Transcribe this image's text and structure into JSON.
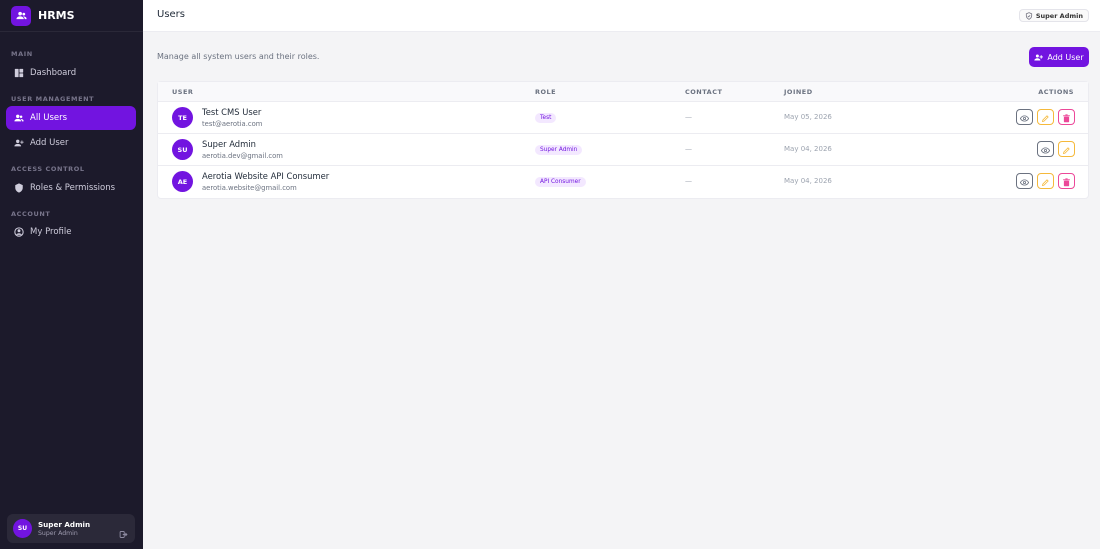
{
  "app": {
    "name": "HRMS"
  },
  "sidebar": {
    "sections": {
      "main": "MAIN",
      "user_management": "USER MANAGEMENT",
      "access_control": "ACCESS CONTROL",
      "account": "ACCOUNT"
    },
    "items": [
      {
        "label": "Dashboard",
        "icon": "dashboard-icon"
      },
      {
        "label": "All Users",
        "icon": "users-icon",
        "active": true
      },
      {
        "label": "Add User",
        "icon": "user-plus-icon"
      },
      {
        "label": "Roles & Permissions",
        "icon": "shield-icon"
      },
      {
        "label": "My Profile",
        "icon": "user-circle-icon"
      }
    ],
    "user_card": {
      "initials": "SU",
      "name": "Super Admin",
      "role": "Super Admin"
    }
  },
  "topbar": {
    "title": "Users",
    "role_chip": "Super Admin"
  },
  "main": {
    "subtitle": "Manage all system users and their roles.",
    "add_button": "Add User"
  },
  "table": {
    "headers": {
      "user": "USER",
      "role": "ROLE",
      "contact": "CONTACT",
      "joined": "JOINED",
      "actions": "ACTIONS"
    },
    "rows": [
      {
        "initials": "TE",
        "name": "Test CMS User",
        "email": "test@aerotia.com",
        "role": "Test",
        "contact": "—",
        "joined": "May 05, 2026",
        "actions": [
          "view",
          "edit",
          "delete"
        ]
      },
      {
        "initials": "SU",
        "name": "Super Admin",
        "email": "aerotia.dev@gmail.com",
        "role": "Super Admin",
        "contact": "—",
        "joined": "May 04, 2026",
        "actions": [
          "view",
          "edit"
        ]
      },
      {
        "initials": "AE",
        "name": "Aerotia Website API Consumer",
        "email": "aerotia.website@gmail.com",
        "role": "API Consumer",
        "contact": "—",
        "joined": "May 04, 2026",
        "actions": [
          "view",
          "edit",
          "delete"
        ]
      }
    ]
  },
  "colors": {
    "accent": "#7214e0",
    "sidebar_bg": "#1c1a2b",
    "badge_bg": "#f3e8ff",
    "edit": "#f5b93b",
    "delete": "#ec4899"
  }
}
